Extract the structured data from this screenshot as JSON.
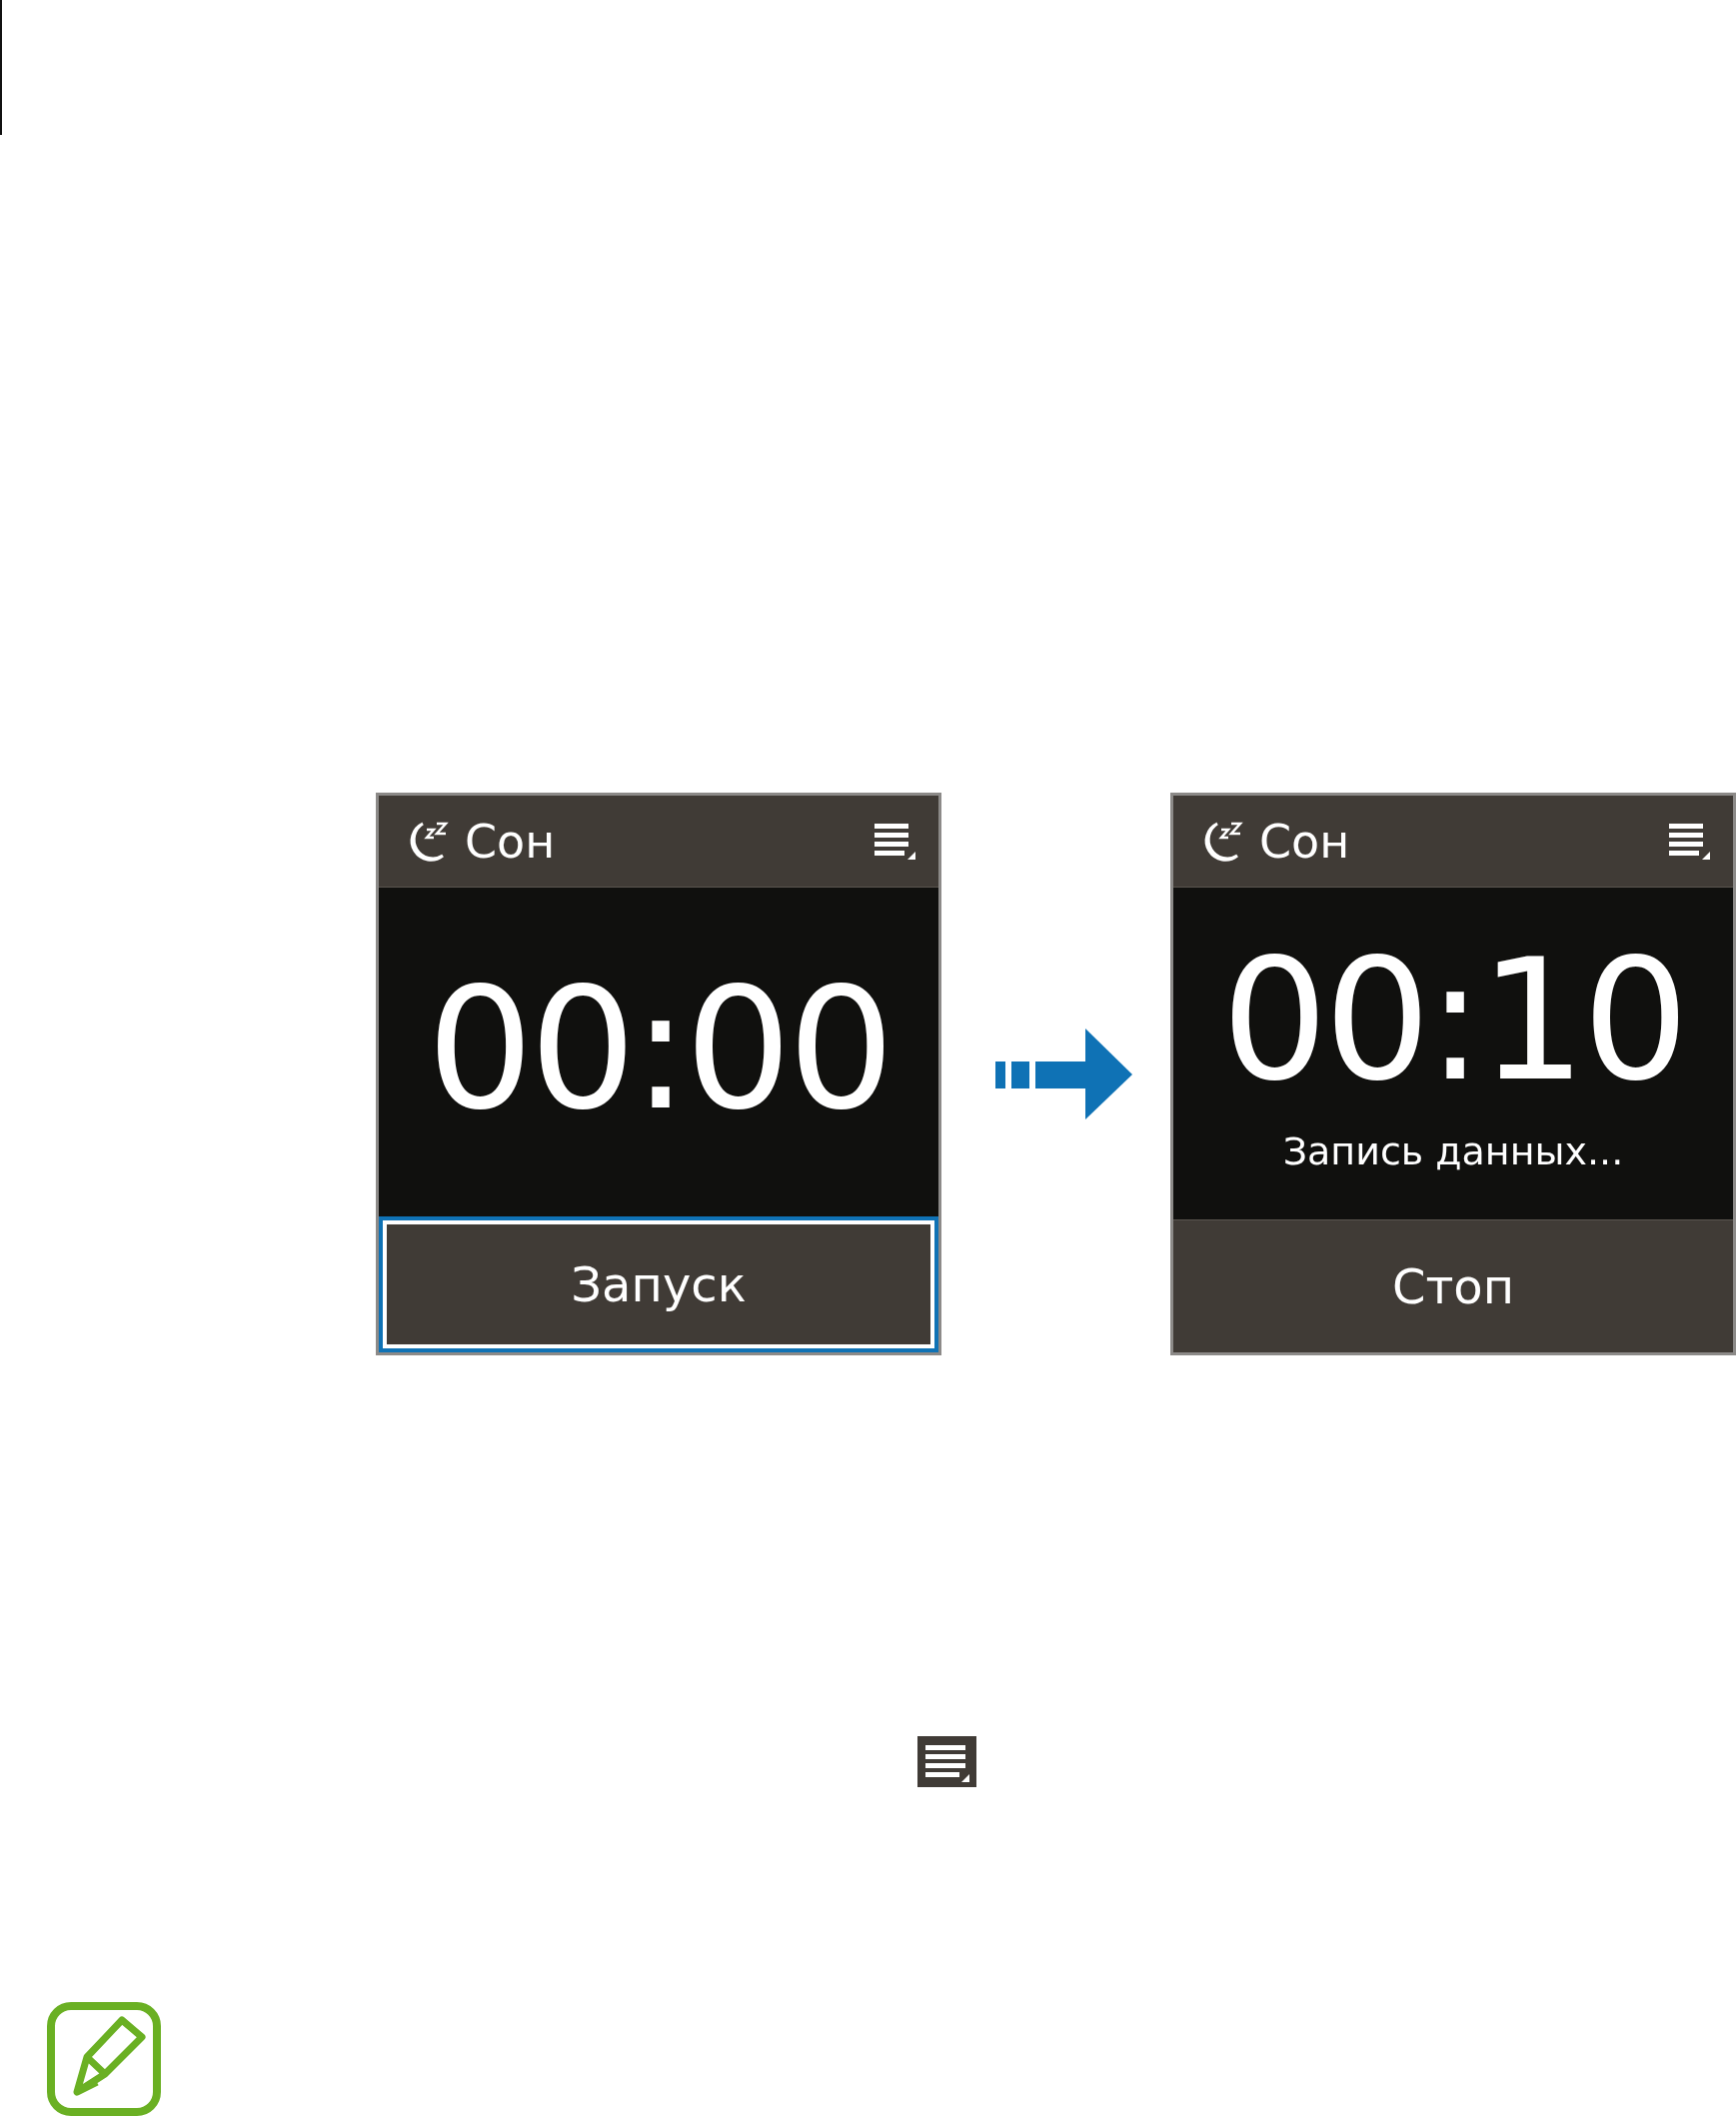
{
  "screens": [
    {
      "title": "Сон",
      "time": "00:00",
      "button": "Запуск",
      "button_highlighted": true
    },
    {
      "title": "Сон",
      "time": "00:10",
      "status": "Запись данных...",
      "button": "Стоп",
      "button_highlighted": false
    }
  ]
}
